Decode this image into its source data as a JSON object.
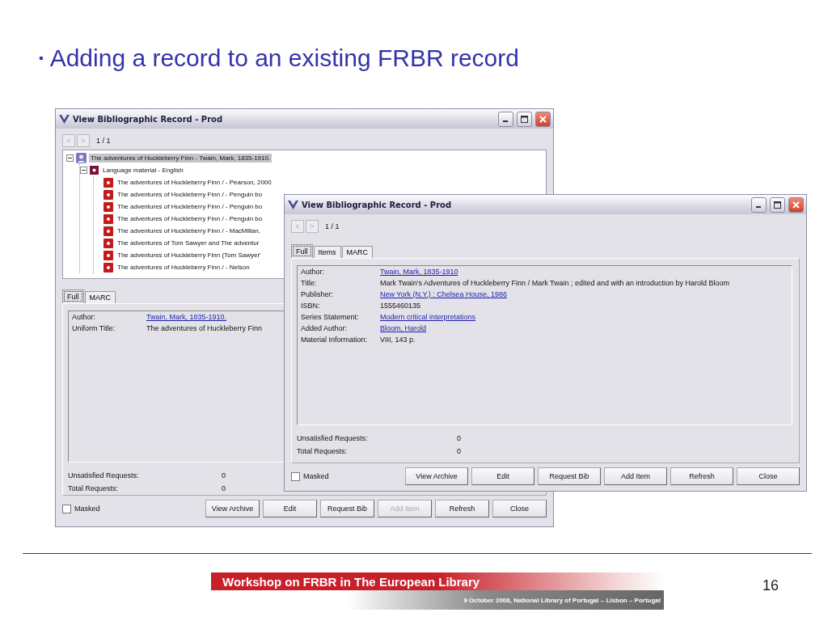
{
  "slide": {
    "bullet": "▪",
    "title": "Adding a record to an existing FRBR record"
  },
  "windows": [
    {
      "title": "View Bibliographic Record - Prod",
      "prev": "<",
      "next": ">",
      "counter": "1 / 1",
      "tree": [
        {
          "label": "The adventures of Huckleberry Finn - Twain, Mark, 1835-1910.",
          "kind": "work",
          "expanded": true,
          "selected": true,
          "children": [
            {
              "label": "Language material - English",
              "kind": "expression",
              "expanded": true,
              "selected": false,
              "children": [
                {
                  "label": "The adventures of Huckleberry Finn / - Pearson, 2000",
                  "kind": "manifestation",
                  "selected": false
                },
                {
                  "label": "The adventures of Huckleberry Finn / - Penguin bo",
                  "kind": "manifestation",
                  "selected": false
                },
                {
                  "label": "The adventures of Huckleberry Finn / - Penguin bo",
                  "kind": "manifestation",
                  "selected": false
                },
                {
                  "label": "The adventures of Huckleberry Finn / - Penguin bo",
                  "kind": "manifestation",
                  "selected": false
                },
                {
                  "label": "The adventures of Huckleberry Finn / - MacMillan,",
                  "kind": "manifestation",
                  "selected": false
                },
                {
                  "label": "The adventures of Tom Sawyer and The adventur",
                  "kind": "manifestation",
                  "selected": false
                },
                {
                  "label": "The adventures of Huckleberry Finn (Tom Sawyer'",
                  "kind": "manifestation",
                  "selected": false
                },
                {
                  "label": "The adventures of Huckleberry Finn / - Nelson",
                  "kind": "manifestation",
                  "selected": false
                }
              ]
            }
          ]
        }
      ],
      "tabs": [
        {
          "label": "Full",
          "selected": true
        },
        {
          "label": "MARC",
          "selected": false
        }
      ],
      "fields": [
        {
          "label": "Author:",
          "value": "Twain, Mark, 1835-1910.",
          "link": true
        },
        {
          "label": "Uniform Title:",
          "value": "The adventures of Huckleberry Finn",
          "link": false
        }
      ],
      "requests": [
        {
          "label": "Unsatisfied Requests:",
          "value": "0"
        },
        {
          "label": "Total Requests:",
          "value": "0"
        }
      ],
      "masked": {
        "label": "Masked",
        "checked": false
      },
      "buttons": [
        {
          "label": "View Archive",
          "disabled": false
        },
        {
          "label": "Edit",
          "disabled": false
        },
        {
          "label": "Request Bib",
          "disabled": false
        },
        {
          "label": "Add Item",
          "disabled": true
        },
        {
          "label": "Refresh",
          "disabled": false
        },
        {
          "label": "Close",
          "disabled": false
        }
      ]
    },
    {
      "title": "View Bibliographic Record - Prod",
      "prev": "<",
      "next": ">",
      "counter": "1 / 1",
      "tabs": [
        {
          "label": "Full",
          "selected": true
        },
        {
          "label": "Items",
          "selected": false
        },
        {
          "label": "MARC",
          "selected": false
        }
      ],
      "fields": [
        {
          "label": "Author:",
          "value": "Twain, Mark, 1835-1910",
          "link": true
        },
        {
          "label": "Title:",
          "value": "Mark Twain's Adventures of Huckleberry Finn / Mark Twain ; edited and with an introduction by Harold Bloom",
          "link": false
        },
        {
          "label": "Publisher:",
          "value": "New York (N.Y.) : Chelsea House, 1986",
          "link": true
        },
        {
          "label": "ISBN:",
          "value": "1555460135",
          "link": false
        },
        {
          "label": "Series Statement:",
          "value": "Modern critical interpretations",
          "link": true
        },
        {
          "label": "Added Author:",
          "value": "Bloom, Harold",
          "link": true
        },
        {
          "label": "Material Information:",
          "value": "VIII, 143 p.",
          "link": false
        }
      ],
      "requests": [
        {
          "label": "Unsatisfied Requests:",
          "value": "0"
        },
        {
          "label": "Total Requests:",
          "value": "0"
        }
      ],
      "masked": {
        "label": "Masked",
        "checked": false
      },
      "buttons": [
        {
          "label": "View Archive",
          "disabled": false
        },
        {
          "label": "Edit",
          "disabled": false
        },
        {
          "label": "Request Bib",
          "disabled": false
        },
        {
          "label": "Add Item",
          "disabled": false
        },
        {
          "label": "Refresh",
          "disabled": false
        },
        {
          "label": "Close",
          "disabled": false
        }
      ]
    }
  ],
  "footer": {
    "banner_title": "Workshop on FRBR in The European Library",
    "banner_subtitle": "9 October 2008, National Library of Portugal – Lisbon – Portugal",
    "page_number": "16"
  }
}
